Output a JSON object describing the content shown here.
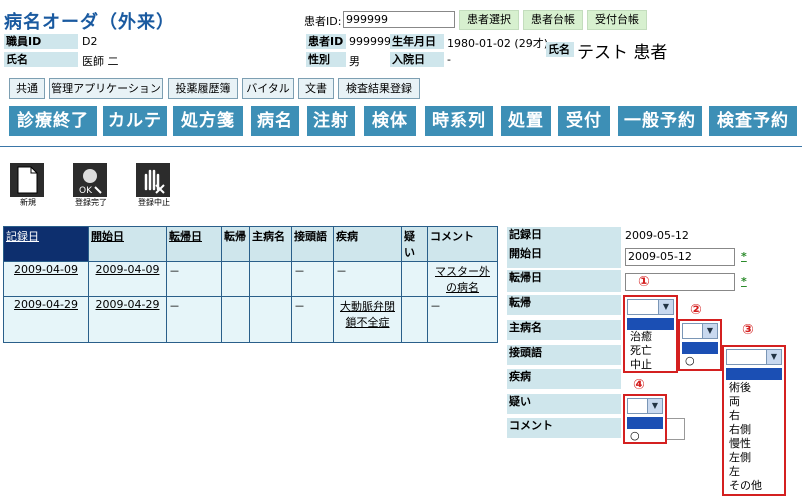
{
  "header": {
    "title": "病名オーダ（外来）",
    "patient_id_label": "患者ID:",
    "patient_id_value": "999999",
    "top_buttons": [
      "患者選択",
      "患者台帳",
      "受付台帳"
    ],
    "staff_id_label": "職員ID",
    "staff_id_value": "D2",
    "doctor_name_label": "氏名",
    "doctor_name_value": "医師 二",
    "pid_label": "患者ID",
    "pid_value": "999999",
    "dob_label": "生年月日",
    "dob_value": "1980-01-02 (29才)",
    "gender_label": "性別",
    "gender_value": "男",
    "admission_label": "入院日",
    "admission_value": "-",
    "patient_name_label": "氏名",
    "patient_name_value": "テスト 患者"
  },
  "sub_menu": [
    "共通",
    "管理アプリケーション",
    "投薬履歴簿",
    "バイタル",
    "文書",
    "検査結果登録"
  ],
  "main_menu": [
    "診療終了",
    "カルテ",
    "処方箋",
    "病名",
    "注射",
    "検体",
    "時系列",
    "処置",
    "受付",
    "一般予約",
    "検査予約"
  ],
  "toolbar": [
    {
      "label": "新規",
      "icon": "new-document-icon"
    },
    {
      "label": "登録完了",
      "icon": "register-complete-icon"
    },
    {
      "label": "登録中止",
      "icon": "register-cancel-icon"
    }
  ],
  "table": {
    "headers": [
      "記録日",
      "開始日",
      "転帰日",
      "転帰",
      "主病名",
      "接頭語",
      "疾病",
      "疑い",
      "コメント"
    ],
    "rows": [
      {
        "record": "2009-04-09",
        "start": "2009-04-09",
        "outcome_date": "－",
        "outcome": "",
        "main": "",
        "prefix": "－",
        "disease": "－",
        "suspect": "",
        "comment": "マスター外の病名"
      },
      {
        "record": "2009-04-29",
        "start": "2009-04-29",
        "outcome_date": "－",
        "outcome": "",
        "main": "",
        "prefix": "－",
        "disease": "大動脈弁閉鎖不全症",
        "suspect": "",
        "comment": "－"
      }
    ]
  },
  "form": {
    "record_date_label": "記録日",
    "record_date_value": "2009-05-12",
    "start_date_label": "開始日",
    "start_date_value": "2009-05-12",
    "outcome_date_label": "転帰日",
    "outcome_date_value": "",
    "required_mark": "*",
    "outcome_label": "転帰",
    "main_label": "主病名",
    "prefix_label": "接頭語",
    "disease_label": "疾病",
    "suspect_label": "疑い",
    "comment_label": "コメント"
  },
  "dropdowns": {
    "outcome_options": [
      "",
      "治癒",
      "死亡",
      "中止"
    ],
    "main_options": [
      "",
      "○"
    ],
    "prefix_options": [
      "",
      "術後",
      "両",
      "右",
      "右側",
      "慢性",
      "左側",
      "左",
      "その他"
    ],
    "suspect_options": [
      "",
      "○"
    ]
  },
  "callouts": [
    "①",
    "②",
    "③",
    "④"
  ]
}
